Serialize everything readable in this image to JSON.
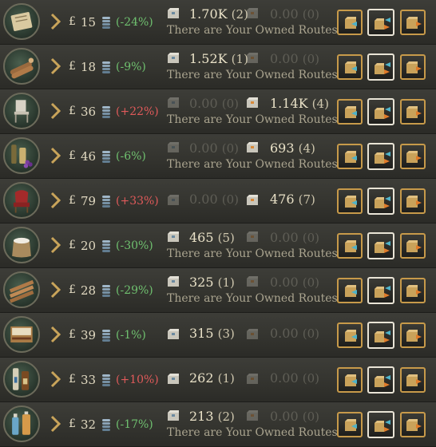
{
  "currency_symbol": "£",
  "colors": {
    "positive": "#e05a5a",
    "negative": "#6fc06f",
    "button_border": "#c79a4a"
  },
  "rows": [
    {
      "good_icon": "paper-icon",
      "price": "15",
      "change": "(-24%)",
      "change_dir": "neg",
      "buy": {
        "amount": "1.70K",
        "count": "(2)",
        "active": true
      },
      "sell": {
        "amount": "0.00",
        "count": "(0)",
        "active": false
      },
      "note": "There are Your Owned Routes"
    },
    {
      "good_icon": "wood-icon",
      "price": "18",
      "change": "(-9%)",
      "change_dir": "neg",
      "buy": {
        "amount": "1.52K",
        "count": "(1)",
        "active": true
      },
      "sell": {
        "amount": "0.00",
        "count": "(0)",
        "active": false
      },
      "note": "There are Your Owned Routes"
    },
    {
      "good_icon": "furniture-icon",
      "price": "36",
      "change": "(+22%)",
      "change_dir": "pos",
      "buy": {
        "amount": "0.00",
        "count": "(0)",
        "active": false
      },
      "sell": {
        "amount": "1.14K",
        "count": "(4)",
        "active": true
      },
      "note": "There are Your Owned Routes"
    },
    {
      "good_icon": "wine-icon",
      "price": "46",
      "change": "(-6%)",
      "change_dir": "neg",
      "buy": {
        "amount": "0.00",
        "count": "(0)",
        "active": false
      },
      "sell": {
        "amount": "693",
        "count": "(4)",
        "active": true
      },
      "note": "There are Your Owned Routes"
    },
    {
      "good_icon": "luxury-furniture-icon",
      "price": "79",
      "change": "(+33%)",
      "change_dir": "pos",
      "buy": {
        "amount": "0.00",
        "count": "(0)",
        "active": false
      },
      "sell": {
        "amount": "476",
        "count": "(7)",
        "active": true
      },
      "note": ""
    },
    {
      "good_icon": "grain-sack-icon",
      "price": "20",
      "change": "(-30%)",
      "change_dir": "neg",
      "buy": {
        "amount": "465",
        "count": "(5)",
        "active": true
      },
      "sell": {
        "amount": "0.00",
        "count": "(0)",
        "active": false
      },
      "note": "There are Your Owned Routes"
    },
    {
      "good_icon": "planks-icon",
      "price": "28",
      "change": "(-29%)",
      "change_dir": "neg",
      "buy": {
        "amount": "325",
        "count": "(1)",
        "active": true
      },
      "sell": {
        "amount": "0.00",
        "count": "(0)",
        "active": false
      },
      "note": "There are Your Owned Routes"
    },
    {
      "good_icon": "cigar-box-icon",
      "price": "39",
      "change": "(-1%)",
      "change_dir": "neg",
      "buy": {
        "amount": "315",
        "count": "(3)",
        "active": true
      },
      "sell": {
        "amount": "0.00",
        "count": "(0)",
        "active": false
      },
      "note": ""
    },
    {
      "good_icon": "liquor-bottles-icon",
      "price": "33",
      "change": "(+10%)",
      "change_dir": "pos",
      "buy": {
        "amount": "262",
        "count": "(1)",
        "active": true
      },
      "sell": {
        "amount": "0.00",
        "count": "(0)",
        "active": false
      },
      "note": ""
    },
    {
      "good_icon": "medicine-bottles-icon",
      "price": "32",
      "change": "(-17%)",
      "change_dir": "neg",
      "buy": {
        "amount": "213",
        "count": "(2)",
        "active": true
      },
      "sell": {
        "amount": "0.00",
        "count": "(0)",
        "active": false
      },
      "note": "There are Your Owned Routes"
    }
  ]
}
